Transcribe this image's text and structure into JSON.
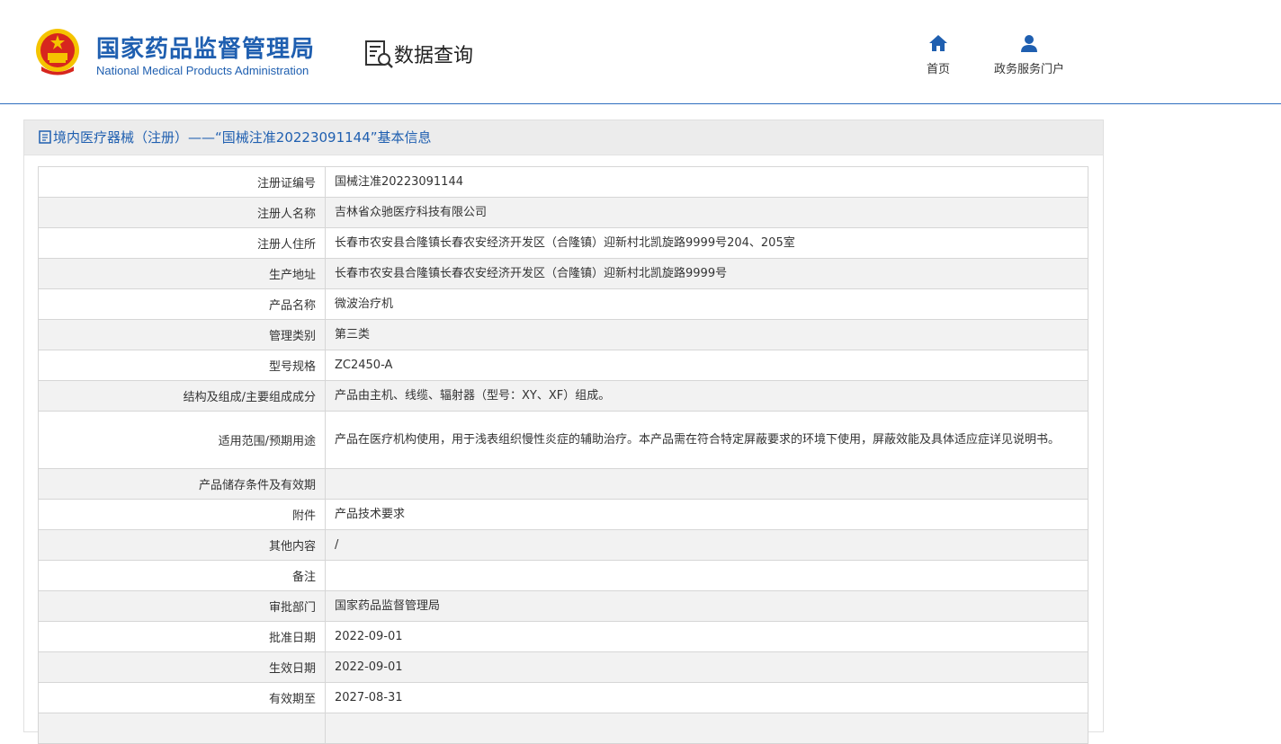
{
  "header": {
    "org_name_cn": "国家药品监督管理局",
    "org_name_en": "National Medical Products Administration",
    "section_title": "数据查询",
    "nav": [
      {
        "label": "首页",
        "icon": "home-icon"
      },
      {
        "label": "政务服务门户",
        "icon": "user-icon"
      }
    ]
  },
  "panel": {
    "title": "境内医疗器械（注册）——“国械注准20223091144”基本信息"
  },
  "rows": [
    {
      "label": "注册证编号",
      "value": "国械注准20223091144"
    },
    {
      "label": "注册人名称",
      "value": "吉林省众驰医疗科技有限公司"
    },
    {
      "label": "注册人住所",
      "value": "长春市农安县合隆镇长春农安经济开发区（合隆镇）迎新村北凯旋路9999号204、205室"
    },
    {
      "label": "生产地址",
      "value": "长春市农安县合隆镇长春农安经济开发区（合隆镇）迎新村北凯旋路9999号"
    },
    {
      "label": "产品名称",
      "value": "微波治疗机"
    },
    {
      "label": "管理类别",
      "value": "第三类"
    },
    {
      "label": "型号规格",
      "value": "ZC2450-A"
    },
    {
      "label": "结构及组成/主要组成成分",
      "value": "产品由主机、线缆、辐射器（型号：XY、XF）组成。"
    },
    {
      "label": "适用范围/预期用途",
      "value": "产品在医疗机构使用，用于浅表组织慢性炎症的辅助治疗。本产品需在符合特定屏蔽要求的环境下使用，屏蔽效能及具体适应症详见说明书。"
    },
    {
      "label": "产品储存条件及有效期",
      "value": ""
    },
    {
      "label": "附件",
      "value": "产品技术要求"
    },
    {
      "label": "其他内容",
      "value": "/"
    },
    {
      "label": "备注",
      "value": ""
    },
    {
      "label": "审批部门",
      "value": "国家药品监督管理局"
    },
    {
      "label": "批准日期",
      "value": "2022-09-01"
    },
    {
      "label": "生效日期",
      "value": "2022-09-01"
    },
    {
      "label": "有效期至",
      "value": "2027-08-31"
    },
    {
      "label": "",
      "value": ""
    }
  ],
  "colors": {
    "brand_blue": "#1f5fb0",
    "alt_row": "#f2f2f2",
    "emblem_red": "#d7261e",
    "emblem_gold": "#f5c400"
  }
}
